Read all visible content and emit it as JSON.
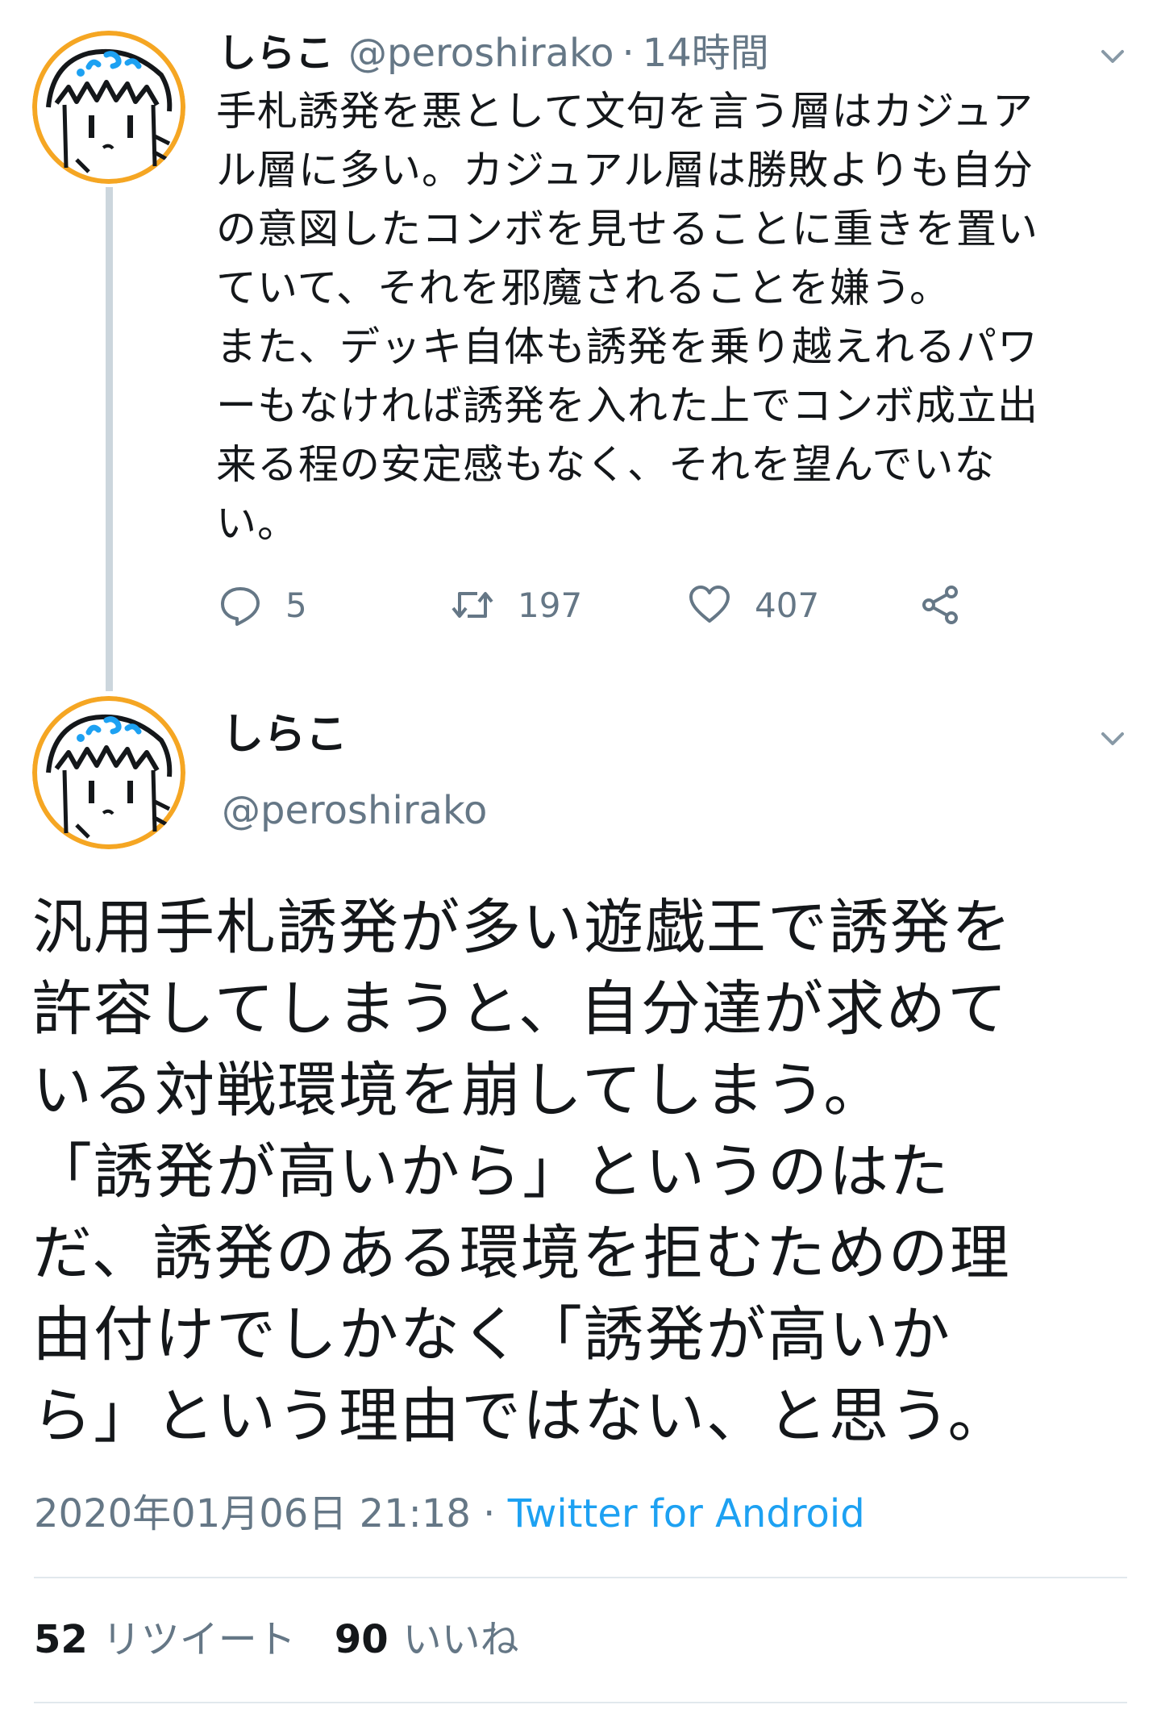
{
  "thread_tweet": {
    "display_name": "しらこ",
    "handle": "@peroshirako",
    "separator": "·",
    "time_ago": "14時間",
    "body_lines": [
      "手札誘発を悪として文句を言う層はカジュア",
      "ル層に多い。カジュアル層は勝敗よりも自分",
      "の意図したコンボを見せることに重きを置い",
      "ていて、それを邪魔されることを嫌う。",
      "また、デッキ自体も誘発を乗り越えれるパワ",
      "ーもなければ誘発を入れた上でコンボ成立出",
      "来る程の安定感もなく、それを望んでいな",
      "い。"
    ],
    "reply_count": "5",
    "retweet_count": "197",
    "like_count": "407"
  },
  "main_tweet": {
    "display_name": "しらこ",
    "handle": "@peroshirako",
    "body_lines": [
      "汎用手札誘発が多い遊戯王で誘発を",
      "許容してしまうと、自分達が求めて",
      "いる対戦環境を崩してしまう。",
      "「誘発が高いから」というのはた",
      "だ、誘発のある環境を拒むための理",
      "由付けでしかなく「誘発が高いか",
      "ら」という理由ではない、と思う。"
    ],
    "timestamp": "2020年01月06日 21:18",
    "separator": "·",
    "client": "Twitter for Android",
    "retweets_count": "52",
    "retweets_label": "リツイート",
    "likes_count": "90",
    "likes_label": "いいね"
  },
  "icons": {
    "reply": "reply-icon",
    "retweet": "retweet-icon",
    "like": "heart-icon",
    "share": "share-icon",
    "menu": "chevron-down-icon"
  },
  "colors": {
    "text": "#14171a",
    "muted": "#657786",
    "link": "#1da1f2",
    "divider": "#e1e8ed",
    "thread_line": "#ccd6dd",
    "avatar_ring": "#f5a623",
    "avatar_accent": "#1da1f2"
  }
}
